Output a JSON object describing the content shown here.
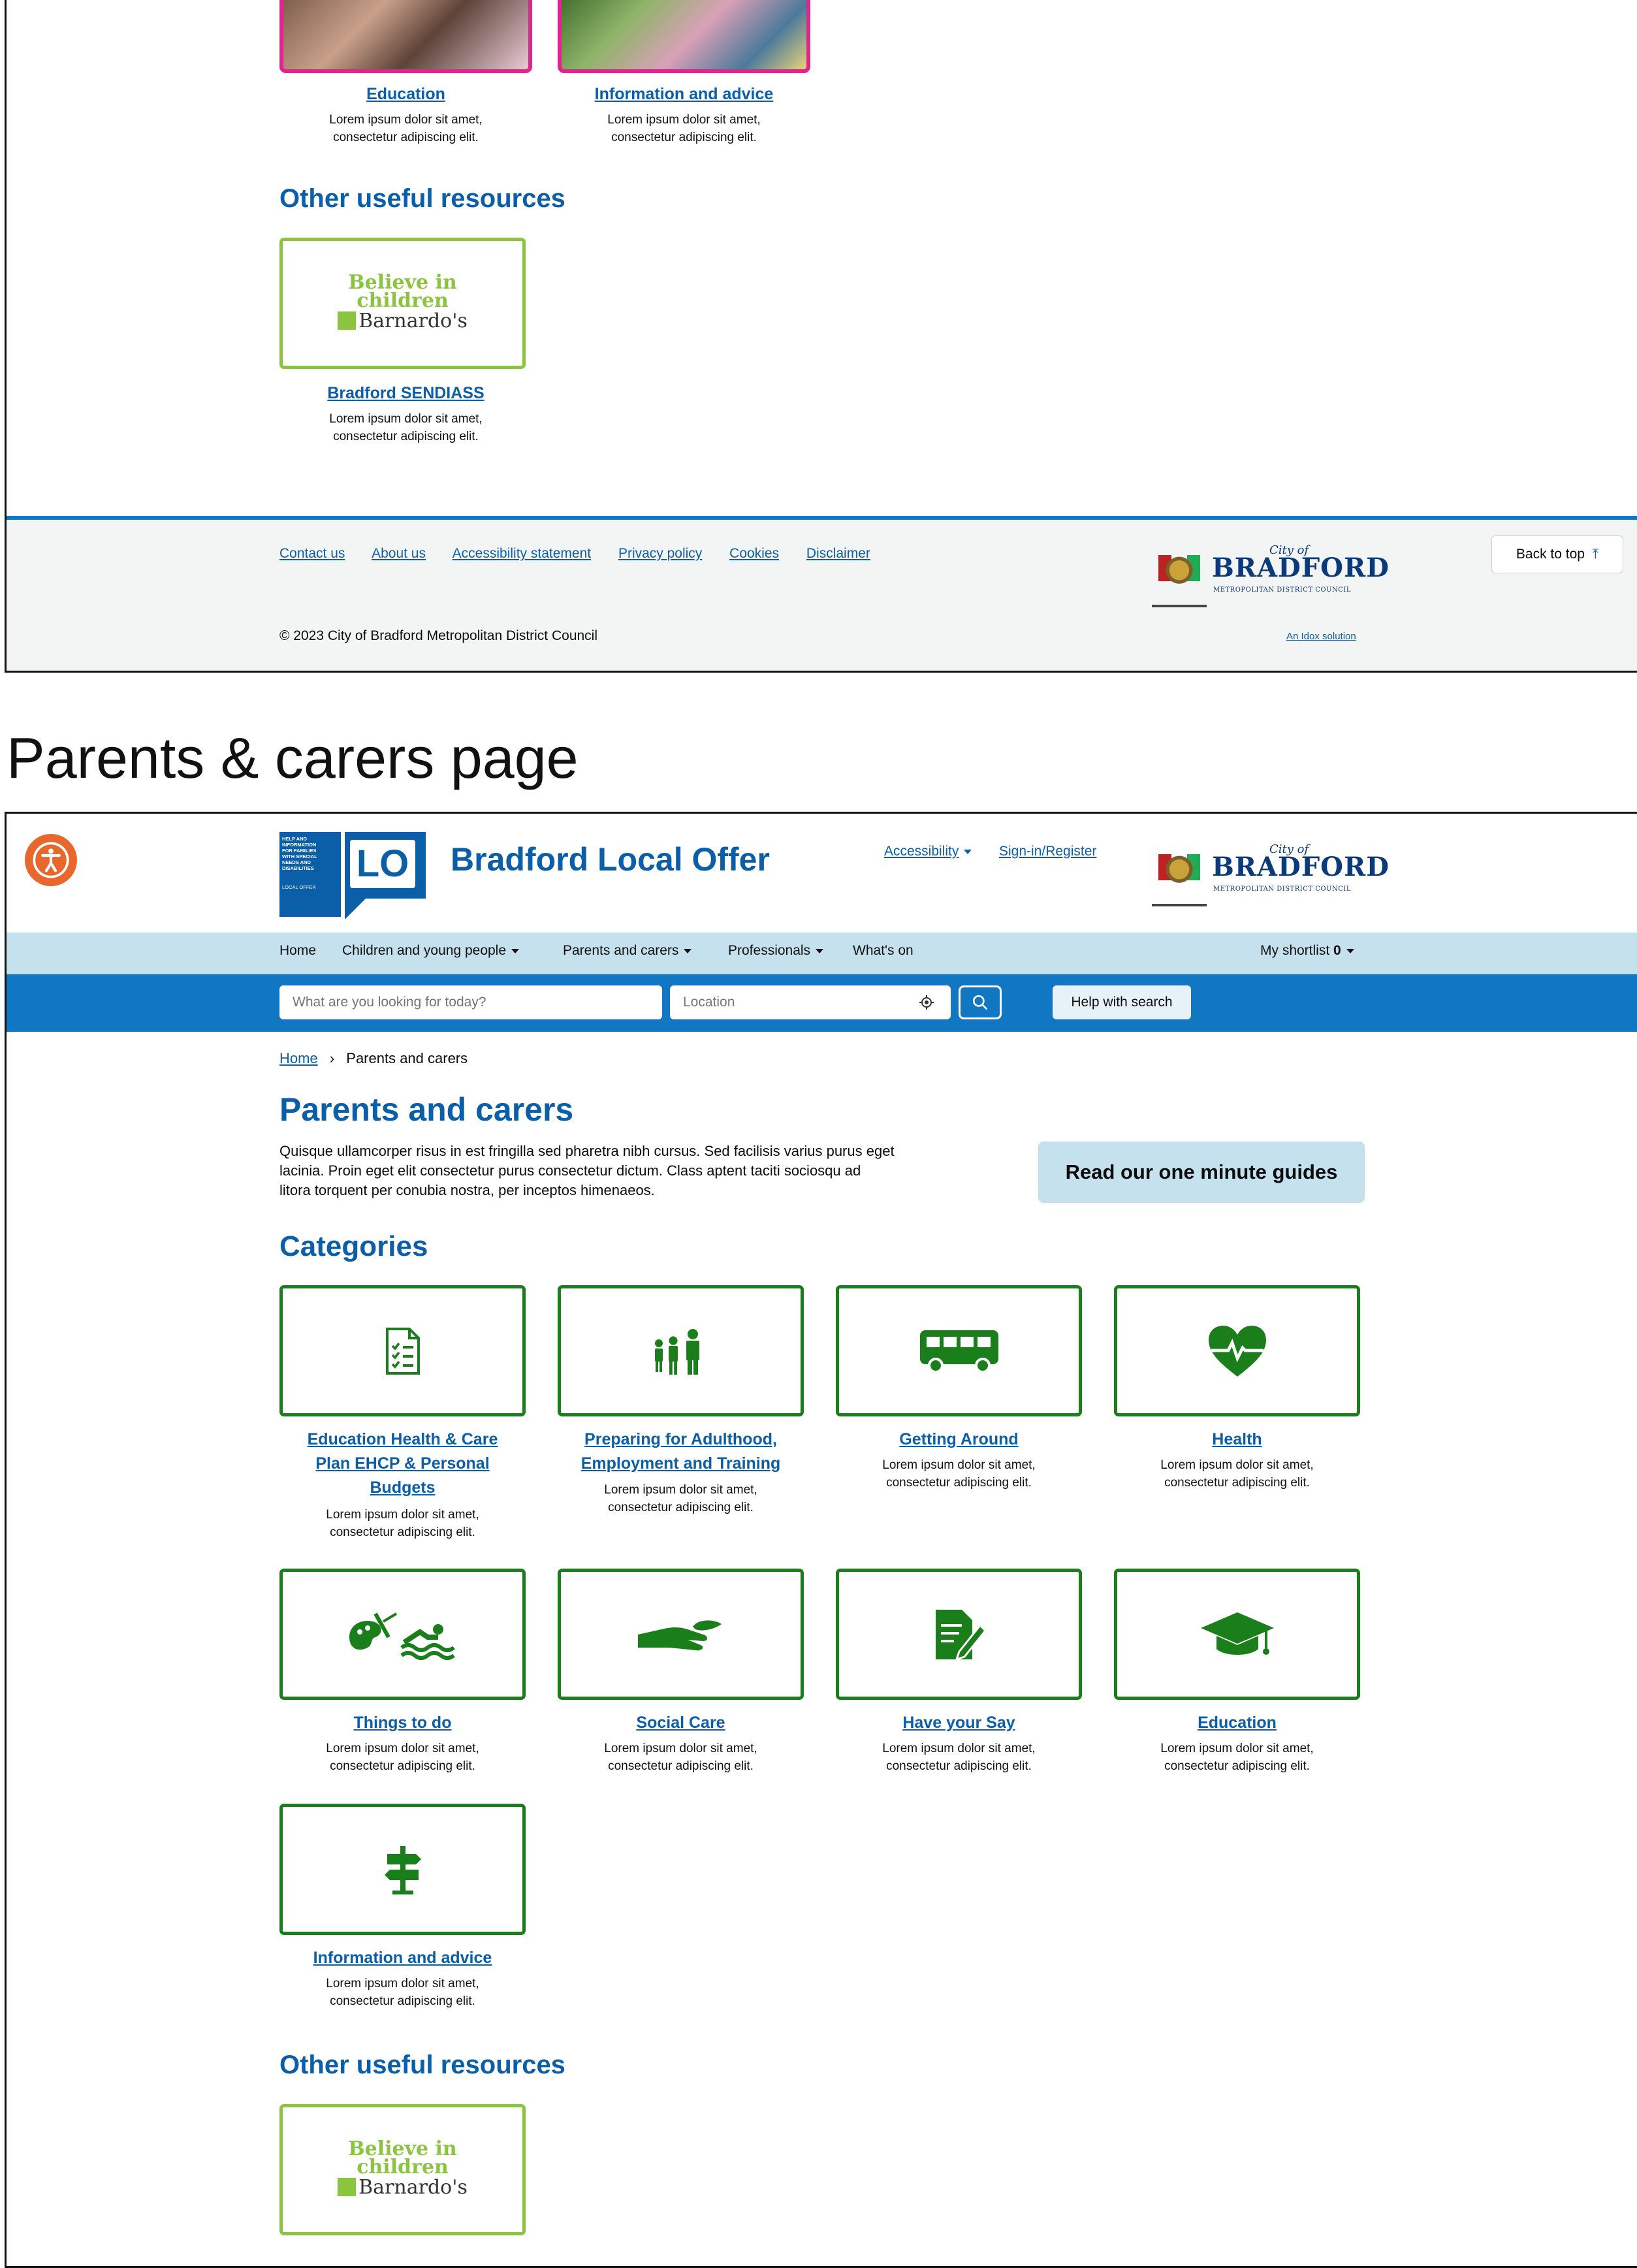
{
  "top_section": {
    "cards": [
      {
        "title": "Education",
        "desc1": "Lorem ipsum dolor sit amet,",
        "desc2": "consectetur adipiscing elit."
      },
      {
        "title": "Information and advice",
        "desc1": "Lorem ipsum dolor sit amet,",
        "desc2": "consectetur adipiscing elit."
      }
    ],
    "other_resources_heading": "Other useful resources",
    "barnardos": {
      "line1": "Believe in",
      "line2": "children",
      "line3": "Barnardo's"
    },
    "sendiass": {
      "title": "Bradford SENDIASS",
      "desc1": "Lorem ipsum dolor sit amet,",
      "desc2": "consectetur adipiscing elit."
    }
  },
  "footer": {
    "links": [
      "Contact us",
      "About us",
      "Accessibility statement",
      "Privacy policy",
      "Cookies",
      "Disclaimer"
    ],
    "copyright": "© 2023 City of Bradford Metropolitan District Council",
    "back_to_top": "Back to top",
    "idox": "An Idox solution"
  },
  "bradford_logo": {
    "city_of": "City of",
    "name": "BRADFORD",
    "council": "METROPOLITAN DISTRICT COUNCIL"
  },
  "section_label": "Parents & carers page",
  "header": {
    "lo_badge_lines": [
      "HELP AND",
      "INFORMATION",
      "FOR FAMILIES",
      "WITH SPECIAL",
      "NEEDS AND",
      "DISABILITIES"
    ],
    "lo_badge_bottom": "LOCAL OFFER",
    "lo": "LO",
    "site_title": "Bradford Local Offer",
    "accessibility": "Accessibility",
    "signin": "Sign-in/Register"
  },
  "nav": {
    "items": [
      "Home",
      "Children and young people",
      "Parents and carers",
      "Professionals",
      "What's on"
    ],
    "shortlist_label": "My shortlist",
    "shortlist_count": "0"
  },
  "search": {
    "placeholder": "What are you looking for today?",
    "location_placeholder": "Location",
    "help": "Help with search"
  },
  "breadcrumb": {
    "home": "Home",
    "separator": "›",
    "current": "Parents and carers"
  },
  "page": {
    "title": "Parents and carers",
    "intro1": "Quisque ullamcorper risus in est fringilla sed pharetra nibh cursus. Sed facilisis varius purus eget",
    "intro2": "lacinia. Proin eget elit consectetur purus consectetur dictum. Class aptent taciti sociosqu ad",
    "intro3": "litora torquent per conubia nostra, per inceptos himenaeos.",
    "guides_button": "Read our one minute guides",
    "categories_heading": "Categories",
    "categories": [
      {
        "icon": "checklist-icon",
        "title_lines": [
          "Education Health & Care",
          "Plan EHCP & Personal",
          "Budgets"
        ],
        "desc1": "Lorem ipsum dolor sit amet,",
        "desc2": "consectetur adipiscing elit."
      },
      {
        "icon": "family-icon",
        "title_lines": [
          "Preparing for Adulthood,",
          "Employment and Training"
        ],
        "desc1": "Lorem ipsum dolor sit amet,",
        "desc2": "consectetur adipiscing elit."
      },
      {
        "icon": "bus-icon",
        "title_lines": [
          "Getting Around"
        ],
        "desc1": "Lorem ipsum dolor sit amet,",
        "desc2": "consectetur adipiscing elit."
      },
      {
        "icon": "heartbeat-icon",
        "title_lines": [
          "Health"
        ],
        "desc1": "Lorem ipsum dolor sit amet,",
        "desc2": "consectetur adipiscing elit."
      },
      {
        "icon": "palette-swimmer-icon",
        "title_lines": [
          "Things to do"
        ],
        "desc1": "Lorem ipsum dolor sit amet,",
        "desc2": "consectetur adipiscing elit."
      },
      {
        "icon": "helping-hand-icon",
        "title_lines": [
          "Social Care"
        ],
        "desc1": "Lorem ipsum dolor sit amet,",
        "desc2": "consectetur adipiscing elit."
      },
      {
        "icon": "document-pen-icon",
        "title_lines": [
          "Have your Say"
        ],
        "desc1": "Lorem ipsum dolor sit amet,",
        "desc2": "consectetur adipiscing elit."
      },
      {
        "icon": "graduation-cap-icon",
        "title_lines": [
          "Education"
        ],
        "desc1": "Lorem ipsum dolor sit amet,",
        "desc2": "consectetur adipiscing elit."
      },
      {
        "icon": "signpost-icon",
        "title_lines": [
          "Information and advice"
        ],
        "desc1": "Lorem ipsum dolor sit amet,",
        "desc2": "consectetur adipiscing elit."
      }
    ],
    "other_resources_heading": "Other useful resources",
    "barnardos": {
      "line1": "Believe in",
      "line2": "children",
      "line3": "Barnardo's"
    }
  },
  "colors": {
    "brand_blue": "#0b5ea8",
    "nav_light": "#c5e1ee",
    "search_bar": "#1277c2",
    "tile_green": "#1a7f1a",
    "barnardos_green": "#8bc53f",
    "pink": "#e0268c",
    "accessibility_orange": "#e8672c"
  }
}
